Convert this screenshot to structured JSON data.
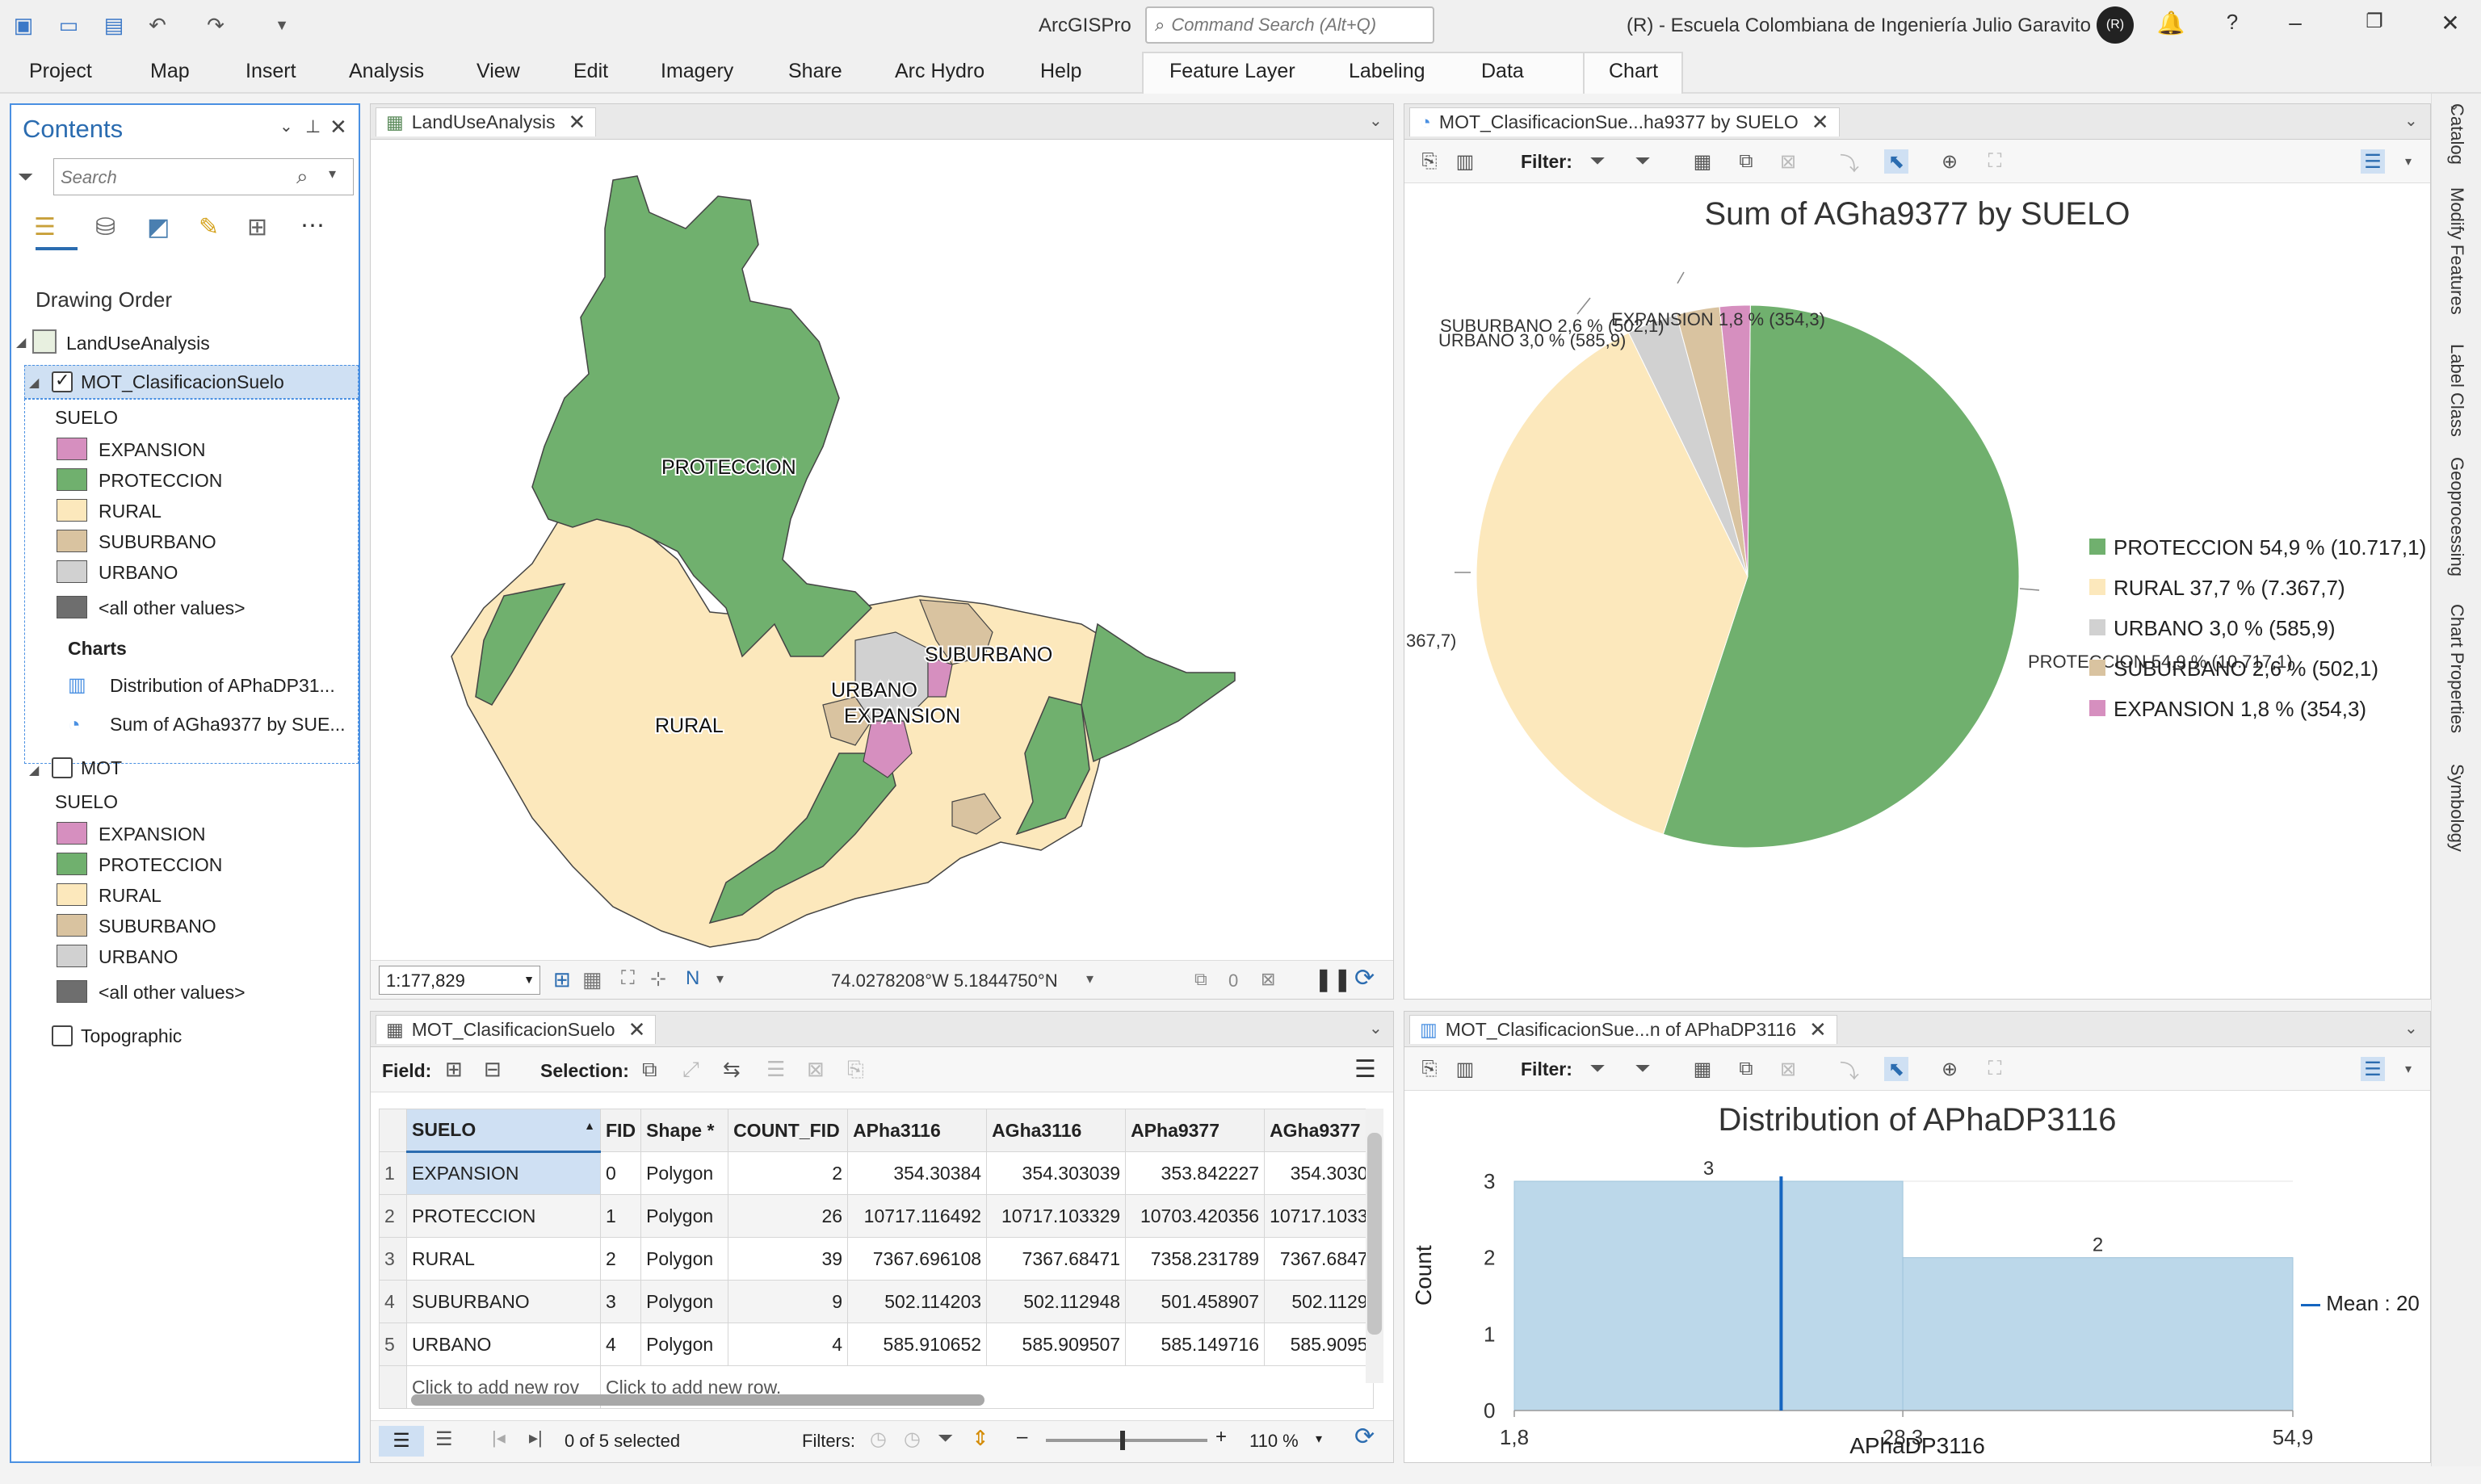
{
  "app": {
    "title": "ArcGISPro",
    "command_search_placeholder": "Command Search (Alt+Q)",
    "organization": "(R) - Escuela Colombiana de Ingeniería Julio Garavito",
    "avatar_initials": "(R)"
  },
  "ribbon": {
    "tabs": [
      "Project",
      "Map",
      "Insert",
      "Analysis",
      "View",
      "Edit",
      "Imagery",
      "Share",
      "Arc Hydro",
      "Help"
    ],
    "context_tabs": [
      "Feature Layer",
      "Labeling",
      "Data"
    ],
    "chart_tab": "Chart"
  },
  "contents": {
    "title": "Contents",
    "search_placeholder": "Search",
    "drawing_order": "Drawing Order",
    "map_name": "LandUseAnalysis",
    "layer1": {
      "name": "MOT_ClasificacionSuelo",
      "field": "SUELO",
      "classes": [
        "EXPANSION",
        "PROTECCION",
        "RURAL",
        "SUBURBANO",
        "URBANO",
        "<all other values>"
      ],
      "charts_label": "Charts",
      "charts": [
        "Distribution of APhaDP31...",
        "Sum of AGha9377 by SUE..."
      ]
    },
    "layer2": {
      "name": "MOT",
      "field": "SUELO",
      "classes": [
        "EXPANSION",
        "PROTECCION",
        "RURAL",
        "SUBURBANO",
        "URBANO",
        "<all other values>"
      ]
    },
    "layer3": {
      "name": "Topographic"
    }
  },
  "colors": {
    "EXPANSION": "#d68fbf",
    "PROTECCION": "#70b06e",
    "RURAL": "#fce8bc",
    "SUBURBANO": "#d9c3a0",
    "URBANO": "#d1d1d1",
    "other": "#6e6e6e",
    "accent": "#2b6cb0",
    "hist": "#bcd8ea"
  },
  "map": {
    "tab": "LandUseAnalysis",
    "labels": [
      "PROTECCION",
      "RURAL",
      "URBANO",
      "EXPANSION",
      "SUBURBANO"
    ],
    "scale": "1:177,829",
    "coordinates": "74.0278208°W 5.1844750°N",
    "selected_count": "0"
  },
  "pie": {
    "tab": "MOT_ClasificacionSue...ha9377 by SUELO",
    "filter_label": "Filter:",
    "chart_data": {
      "type": "pie",
      "title": "Sum of AGha9377 by SUELO",
      "slices": [
        {
          "name": "PROTECCION",
          "percent": 54.9,
          "value": 10717.1,
          "legend": "PROTECCION 54,9 % (10.717,1)"
        },
        {
          "name": "RURAL",
          "percent": 37.7,
          "value": 7367.7,
          "legend": "RURAL 37,7 % (7.367,7)"
        },
        {
          "name": "URBANO",
          "percent": 3.0,
          "value": 585.9,
          "legend": "URBANO 3,0 % (585,9)"
        },
        {
          "name": "SUBURBANO",
          "percent": 2.6,
          "value": 502.1,
          "legend": "SUBURBANO 2,6 % (502,1)"
        },
        {
          "name": "EXPANSION",
          "percent": 1.8,
          "value": 354.3,
          "legend": "EXPANSION 1,8 % (354,3)"
        }
      ],
      "outer_labels": [
        "SUBURBANO 2,6 % (502,1)",
        "EXPANSION 1,8 % (354,3)",
        "URBANO 3,0 % (585,9)",
        "367,7)",
        "PROTECCION 54,9 % (10.717,1)"
      ],
      "legend_position": "right"
    }
  },
  "histogram": {
    "tab": "MOT_ClasificacionSue...n of APhaDP3116",
    "filter_label": "Filter:",
    "chart_data": {
      "type": "bar",
      "title": "Distribution of APhaDP3116",
      "xlabel": "APhaDP3116",
      "ylabel": "Count",
      "bins": [
        {
          "from": 1.8,
          "to": 28.3,
          "count": 3
        },
        {
          "from": 28.3,
          "to": 54.9,
          "count": 2
        }
      ],
      "x_ticks": [
        "1,8",
        "28,3",
        "54,9"
      ],
      "y_ticks": [
        "0",
        "1",
        "2",
        "3"
      ],
      "ylim": [
        0,
        3
      ],
      "xlim": [
        1.8,
        54.9
      ],
      "mean": 20,
      "mean_label": "Mean : 20",
      "grid": true
    }
  },
  "table": {
    "tab": "MOT_ClasificacionSuelo",
    "field_label": "Field:",
    "selection_label": "Selection:",
    "columns": [
      "SUELO",
      "FID",
      "Shape *",
      "COUNT_FID",
      "APha3116",
      "AGha3116",
      "APha9377",
      "AGha9377"
    ],
    "rows": [
      [
        "1",
        "EXPANSION",
        "0",
        "Polygon",
        "2",
        "354.30384",
        "354.303039",
        "353.842227",
        "354.3030"
      ],
      [
        "2",
        "PROTECCION",
        "1",
        "Polygon",
        "26",
        "10717.116492",
        "10717.103329",
        "10703.420356",
        "10717.1033"
      ],
      [
        "3",
        "RURAL",
        "2",
        "Polygon",
        "39",
        "7367.696108",
        "7367.68471",
        "7358.231789",
        "7367.6847"
      ],
      [
        "4",
        "SUBURBANO",
        "3",
        "Polygon",
        "9",
        "502.114203",
        "502.112948",
        "501.458907",
        "502.1129"
      ],
      [
        "5",
        "URBANO",
        "4",
        "Polygon",
        "4",
        "585.910652",
        "585.909507",
        "585.149716",
        "585.9095"
      ]
    ],
    "add_row": "Click to add new row.",
    "add_row_short": "Click to add new rov",
    "selected": "0 of 5 selected",
    "filters_label": "Filters:",
    "zoom": "110 %"
  },
  "rightdock": [
    "Catalog",
    "Modify Features",
    "Label Class",
    "Geoprocessing",
    "Chart Properties",
    "Symbology"
  ]
}
